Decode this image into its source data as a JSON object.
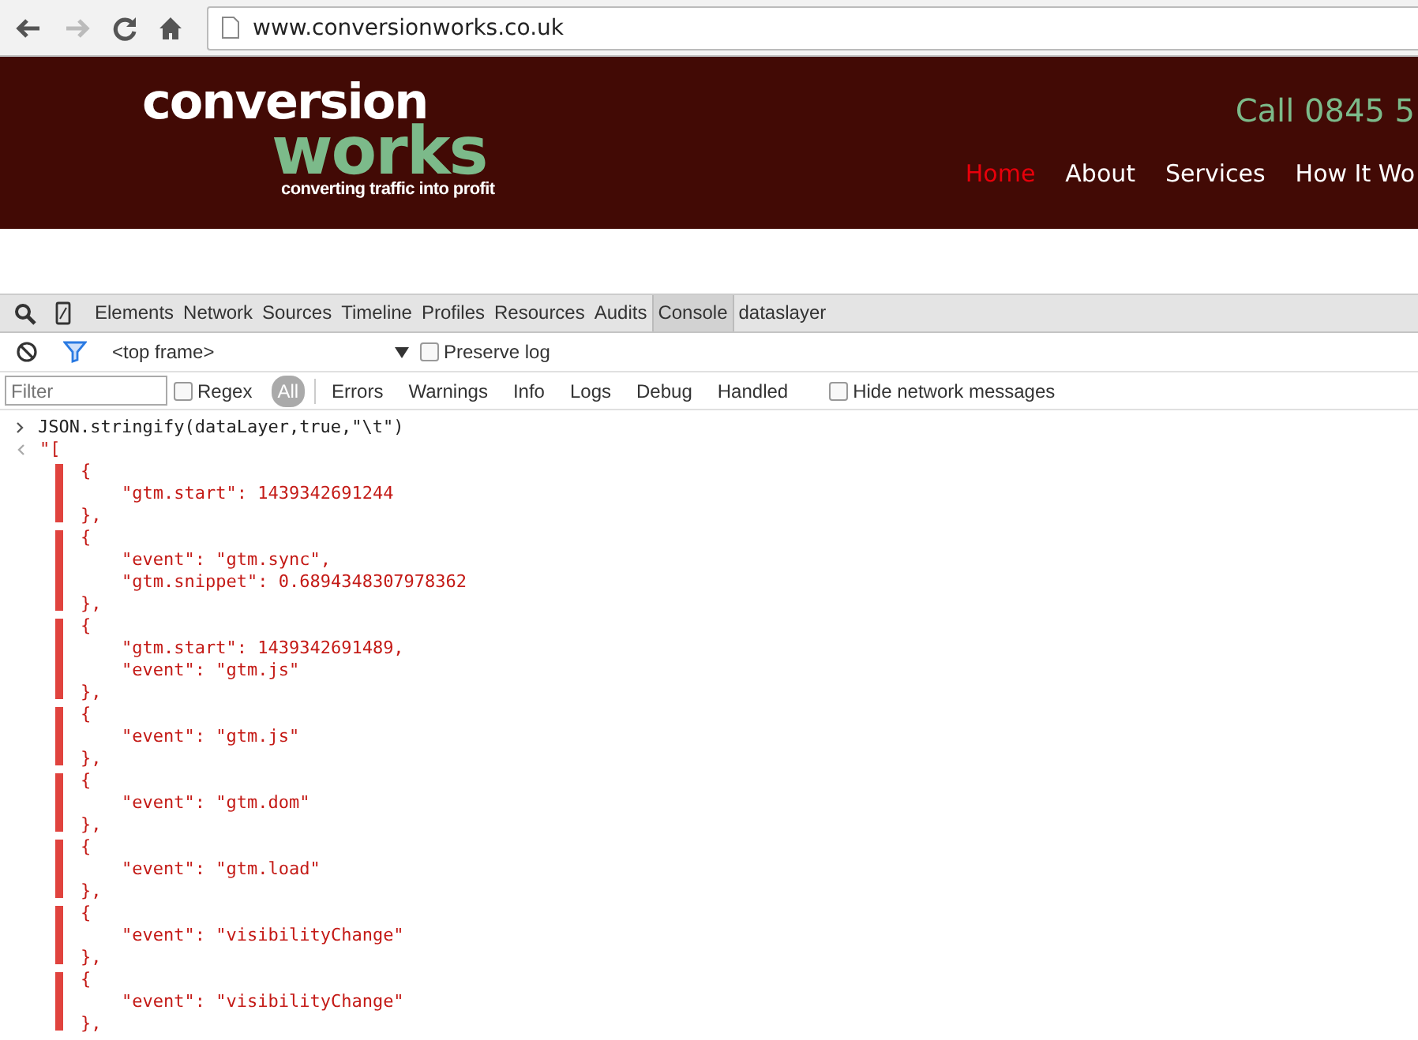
{
  "browser": {
    "url": "www.conversionworks.co.uk"
  },
  "site": {
    "logo_top": "conversion",
    "logo_bottom": "works",
    "tagline": "converting traffic into profit",
    "phone": "Call 0845 5",
    "nav": [
      {
        "label": "Home",
        "selected": true
      },
      {
        "label": "About",
        "selected": false
      },
      {
        "label": "Services",
        "selected": false
      },
      {
        "label": "How It Wo",
        "selected": false
      }
    ]
  },
  "devtools": {
    "tabs": [
      {
        "label": "Elements",
        "selected": false
      },
      {
        "label": "Network",
        "selected": false
      },
      {
        "label": "Sources",
        "selected": false
      },
      {
        "label": "Timeline",
        "selected": false
      },
      {
        "label": "Profiles",
        "selected": false
      },
      {
        "label": "Resources",
        "selected": false
      },
      {
        "label": "Audits",
        "selected": false
      },
      {
        "label": "Console",
        "selected": true
      },
      {
        "label": "dataslayer",
        "selected": false
      }
    ],
    "frame": "<top frame>",
    "preserve_log": {
      "label": "Preserve log",
      "checked": false
    },
    "filter": {
      "placeholder": "Filter"
    },
    "regex": {
      "label": "Regex",
      "checked": false
    },
    "levels": [
      {
        "label": "All",
        "selected": true
      },
      {
        "label": "Errors",
        "selected": false
      },
      {
        "label": "Warnings",
        "selected": false
      },
      {
        "label": "Info",
        "selected": false
      },
      {
        "label": "Logs",
        "selected": false
      },
      {
        "label": "Debug",
        "selected": false
      },
      {
        "label": "Handled",
        "selected": false
      }
    ],
    "hide_network": {
      "label": "Hide network messages",
      "checked": false
    }
  },
  "console": {
    "command": "JSON.stringify(dataLayer,true,\"\\t\")",
    "result_start": "\"[",
    "objects": [
      {
        "open": "{",
        "properties": [
          "\"gtm.start\": 1439342691244"
        ],
        "close": "},"
      },
      {
        "open": "{",
        "properties": [
          "\"event\": \"gtm.sync\",",
          "\"gtm.snippet\": 0.6894348307978362"
        ],
        "close": "},"
      },
      {
        "open": "{",
        "properties": [
          "\"gtm.start\": 1439342691489,",
          "\"event\": \"gtm.js\""
        ],
        "close": "},"
      },
      {
        "open": "{",
        "properties": [
          "\"event\": \"gtm.js\""
        ],
        "close": "},"
      },
      {
        "open": "{",
        "properties": [
          "\"event\": \"gtm.dom\""
        ],
        "close": "},"
      },
      {
        "open": "{",
        "properties": [
          "\"event\": \"gtm.load\""
        ],
        "close": "},"
      },
      {
        "open": "{",
        "properties": [
          "\"event\": \"visibilityChange\""
        ],
        "close": "},"
      },
      {
        "open": "{",
        "properties": [
          "\"event\": \"visibilityChange\""
        ],
        "close": "},"
      }
    ]
  }
}
